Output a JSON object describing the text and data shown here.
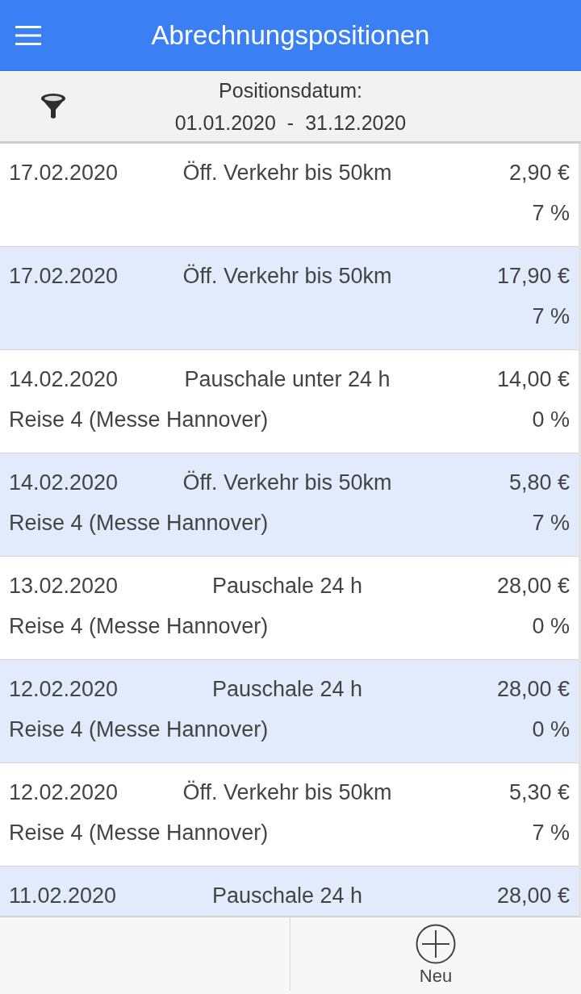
{
  "header": {
    "title": "Abrechnungspositionen"
  },
  "filter": {
    "label": "Positionsdatum:",
    "date_from": "01.01.2020",
    "separator": "-",
    "date_to": "31.12.2020"
  },
  "positions": [
    {
      "date": "17.02.2020",
      "description": "Öff. Verkehr bis 50km",
      "amount": "2,90 €",
      "vat": "7 %"
    },
    {
      "date": "17.02.2020",
      "description": "Öff. Verkehr bis 50km",
      "amount": "17,90 €",
      "vat": "7 %"
    },
    {
      "date": "14.02.2020",
      "description": "Pauschale unter 24 h",
      "amount": "14,00 €",
      "trip": "Reise 4 (Messe Hannover)",
      "vat": "0 %"
    },
    {
      "date": "14.02.2020",
      "description": "Öff. Verkehr bis 50km",
      "amount": "5,80 €",
      "trip": "Reise 4 (Messe Hannover)",
      "vat": "7 %"
    },
    {
      "date": "13.02.2020",
      "description": "Pauschale 24 h",
      "amount": "28,00 €",
      "trip": "Reise 4 (Messe Hannover)",
      "vat": "0 %"
    },
    {
      "date": "12.02.2020",
      "description": "Pauschale 24 h",
      "amount": "28,00 €",
      "trip": "Reise 4 (Messe Hannover)",
      "vat": "0 %"
    },
    {
      "date": "12.02.2020",
      "description": "Öff. Verkehr bis 50km",
      "amount": "5,30 €",
      "trip": "Reise 4 (Messe Hannover)",
      "vat": "7 %"
    },
    {
      "date": "11.02.2020",
      "description": "Pauschale 24 h",
      "amount": "28,00 €"
    }
  ],
  "bottom_bar": {
    "new_button": {
      "label": "Neu"
    }
  }
}
